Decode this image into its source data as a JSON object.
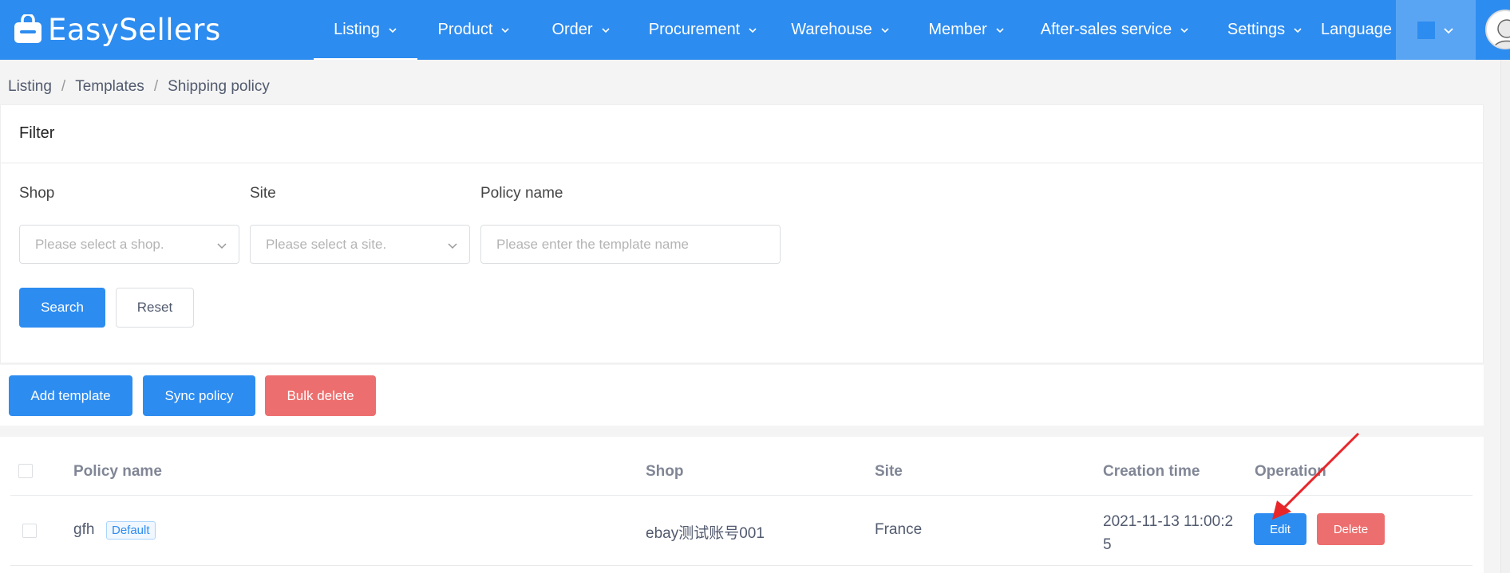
{
  "brand": {
    "name": "EasySellers"
  },
  "nav": {
    "items": [
      {
        "label": "Listing"
      },
      {
        "label": "Product"
      },
      {
        "label": "Order"
      },
      {
        "label": "Procurement"
      },
      {
        "label": "Warehouse"
      },
      {
        "label": "Member"
      },
      {
        "label": "After-sales service"
      },
      {
        "label": "Settings"
      }
    ],
    "active_index": 0,
    "language_label": "Language"
  },
  "breadcrumb": [
    "Listing",
    "Templates",
    "Shipping policy"
  ],
  "filter": {
    "title": "Filter",
    "shop_label": "Shop",
    "shop_placeholder": "Please select a shop.",
    "site_label": "Site",
    "site_placeholder": "Please select a site.",
    "policy_label": "Policy name",
    "policy_placeholder": "Please enter the template name",
    "search_label": "Search",
    "reset_label": "Reset"
  },
  "actions": {
    "add_label": "Add template",
    "sync_label": "Sync policy",
    "bulk_delete_label": "Bulk delete"
  },
  "table": {
    "headers": [
      "Policy name",
      "Shop",
      "Site",
      "Creation time",
      "Operation"
    ],
    "rows": [
      {
        "policy_name": "gfh",
        "tag": "Default",
        "shop": "ebay测试账号001",
        "site": "France",
        "created_line1": "2021-11-13 11:00:2",
        "created_line2": "5",
        "edit_label": "Edit",
        "delete_label": "Delete"
      }
    ]
  },
  "colors": {
    "primary": "#2d8cf0",
    "danger": "#ed6e6e",
    "annotation_arrow": "#e8262a"
  }
}
